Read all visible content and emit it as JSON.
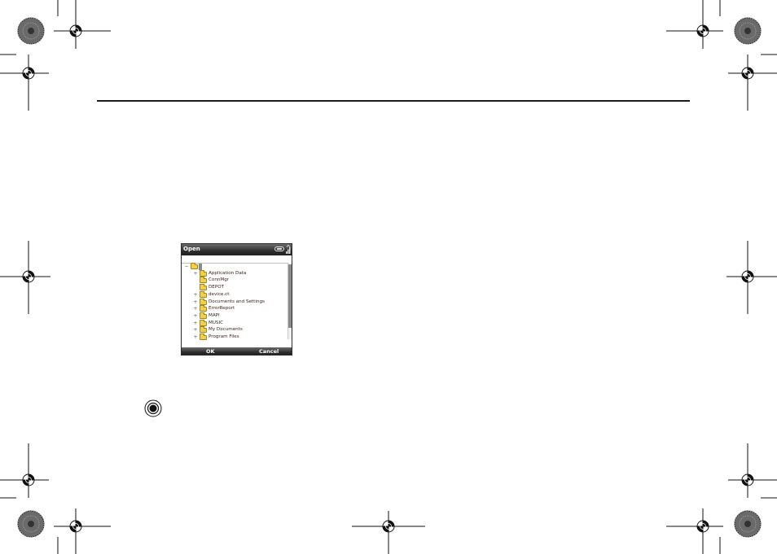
{
  "phone_screen": {
    "title": "Open",
    "tree": {
      "root_expander": "−",
      "items": [
        {
          "label": "Application Data",
          "expander": "+"
        },
        {
          "label": "ConnMgr",
          "expander": ""
        },
        {
          "label": "DEPOT",
          "expander": ""
        },
        {
          "label": "device.ct",
          "expander": "+"
        },
        {
          "label": "Documents and Settings",
          "expander": "+"
        },
        {
          "label": "ErrorReport",
          "expander": "+"
        },
        {
          "label": "MAPI",
          "expander": "+"
        },
        {
          "label": "MUSIC",
          "expander": "+"
        },
        {
          "label": "My Documents",
          "expander": "+"
        },
        {
          "label": "Program Files",
          "expander": "+"
        }
      ]
    },
    "softkeys": {
      "left": "OK",
      "right": "Cancel"
    }
  },
  "icons": {
    "battery": "battery-icon",
    "signal": "signal-strength-icon",
    "folder": "folder-icon",
    "center_key": "center-select-key-icon"
  },
  "colors": {
    "title_bar": "#2e2e2e",
    "folder": "#f2cf4a",
    "item_text": "#3a2418"
  }
}
